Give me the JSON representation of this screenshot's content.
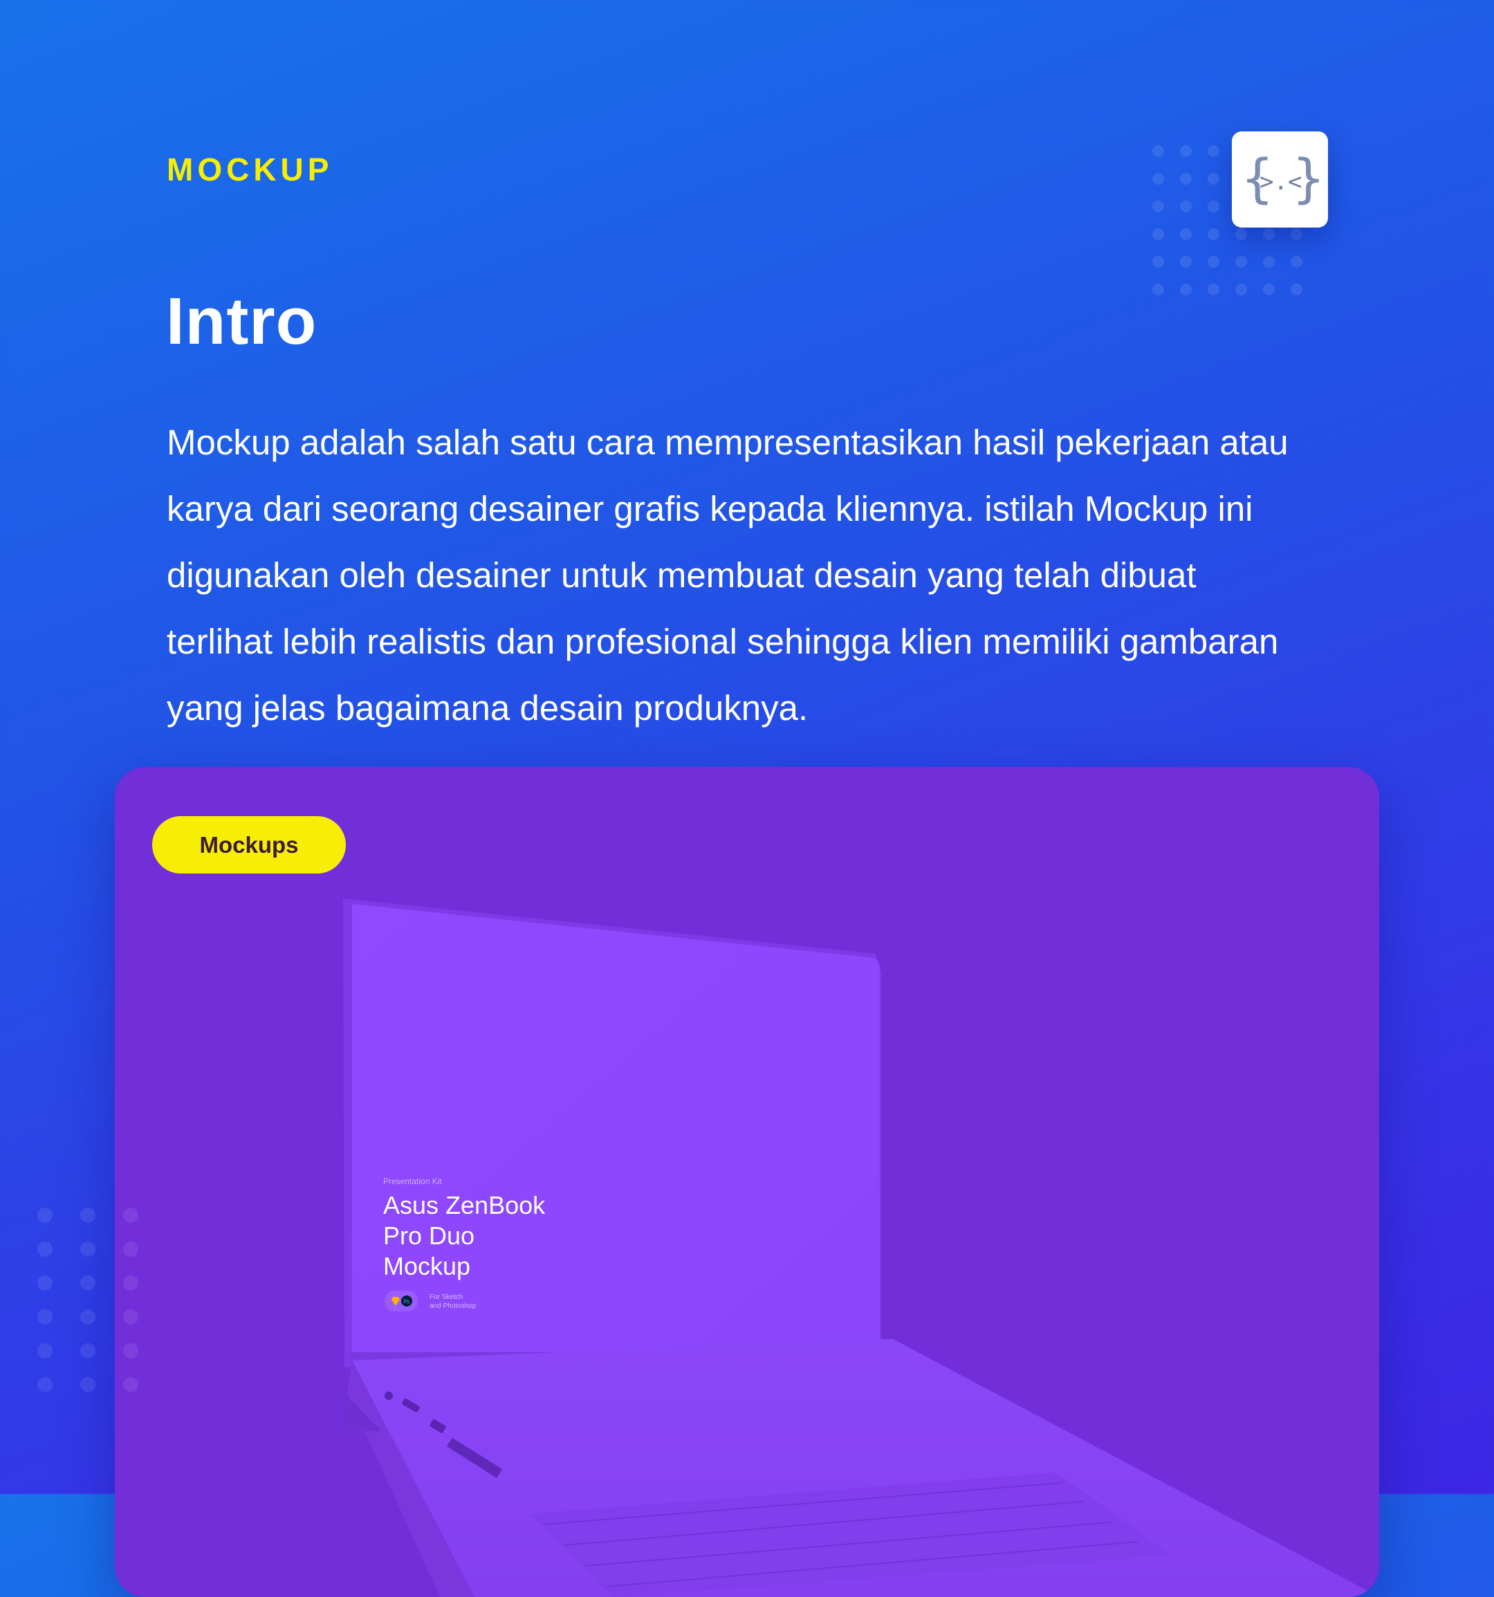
{
  "header": {
    "eyebrow": "MOCKUP",
    "title": "Intro"
  },
  "intro": {
    "paragraph_lines": [
      "Mockup adalah salah satu cara mempresentasikan hasil pekerjaan atau",
      "karya dari seorang desainer grafis kepada kliennya. istilah Mockup ini",
      "digunakan oleh desainer untuk membuat desain yang  telah dibuat",
      "terlihat lebih realistis dan profesional sehingga klien memiliki gambaran",
      "yang jelas bagaimana desain produknya."
    ]
  },
  "logo": {
    "glyph_left": "{",
    "glyph_mid": ">.<",
    "glyph_right": "}",
    "icon": "code-face-icon"
  },
  "card": {
    "tag_label": "Mockups",
    "screen": {
      "kicker": "Presentation Kit",
      "title_lines": [
        "Asus ZenBook",
        "Pro Duo",
        "Mockup"
      ],
      "sub_lines": [
        "For Sketch",
        "and Photoshop"
      ]
    }
  },
  "colors": {
    "accent": "#f7ef00",
    "background_start": "#1872ea",
    "background_end": "#3d26e4",
    "card": "#722ed9",
    "laptop": "#8f4bfd"
  }
}
